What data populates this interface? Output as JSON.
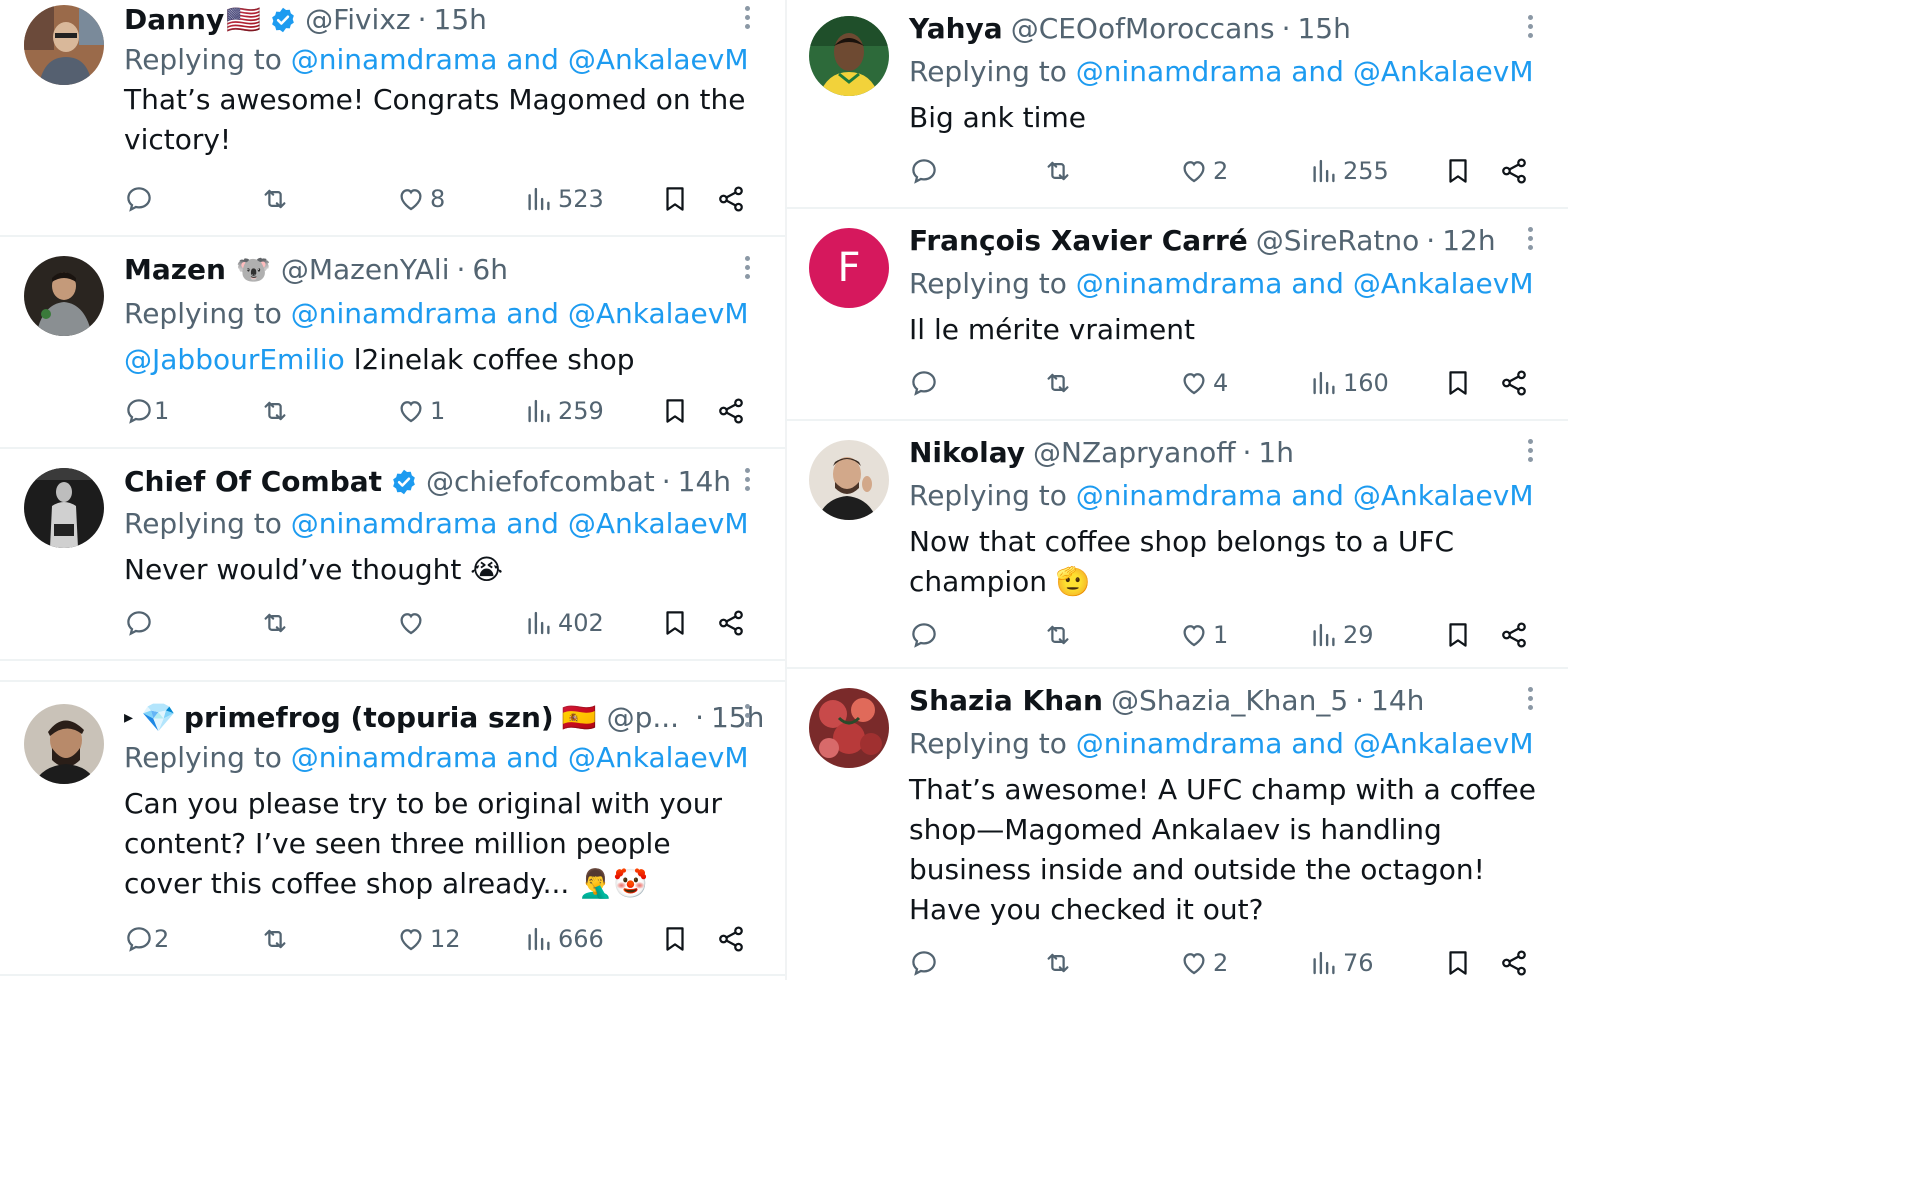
{
  "colors": {
    "mention": "#1d9bf0",
    "muted": "#536471",
    "text": "#0f1419",
    "verified": "#1d9bf0"
  },
  "left_column": [
    {
      "name": "Danny",
      "name_emoji": "🇺🇸",
      "verified": true,
      "handle": "@Fivixz",
      "time": "15h",
      "replying_prefix": "Replying to",
      "replying_mentions": "@ninamdrama and @AnkalaevM",
      "body": "That’s awesome! Congrats Magomed on the victory!",
      "counts": {
        "replies": "",
        "reposts": "",
        "likes": "8",
        "views": "523"
      }
    },
    {
      "name": "Mazen",
      "name_emoji": "🐨",
      "verified": false,
      "handle": "@MazenYAli",
      "time": "6h",
      "replying_prefix": "Replying to",
      "replying_mentions": "@ninamdrama and @AnkalaevM",
      "body_mention": "@JabbourEmilio",
      "body": " l2inelak coffee shop",
      "counts": {
        "replies": "1",
        "reposts": "",
        "likes": "1",
        "views": "259"
      }
    },
    {
      "name": "Chief Of Combat",
      "verified": true,
      "handle": "@chiefofcombat",
      "time": "14h",
      "replying_prefix": "Replying to",
      "replying_mentions": "@ninamdrama and @AnkalaevM",
      "body": "Never would’ve thought 😭",
      "counts": {
        "replies": "",
        "reposts": "",
        "likes": "",
        "views": "402"
      }
    },
    {
      "caret": "▸",
      "name_prefix_emoji": "💎",
      "name": "primefrog (topuria szn)",
      "name_emoji": "🇪🇸",
      "verified": false,
      "handle": "@p...",
      "time": "15h",
      "replying_prefix": "Replying to",
      "replying_mentions": "@ninamdrama and @AnkalaevM",
      "body": "Can you please try to be original with your content? I’ve seen three million people cover this coffee shop already... 🤦‍♂️🤡",
      "counts": {
        "replies": "2",
        "reposts": "",
        "likes": "12",
        "views": "666"
      }
    }
  ],
  "right_column": [
    {
      "name": "Yahya",
      "verified": false,
      "handle": "@CEOofMoroccans",
      "time": "15h",
      "replying_prefix": "Replying to",
      "replying_mentions": "@ninamdrama and @AnkalaevM",
      "body": "Big ank time",
      "counts": {
        "replies": "",
        "reposts": "",
        "likes": "2",
        "views": "255"
      }
    },
    {
      "avatar_letter": "F",
      "name": "François Xavier Carré",
      "verified": false,
      "handle": "@SireRatno",
      "time": "12h",
      "replying_prefix": "Replying to",
      "replying_mentions": "@ninamdrama and @AnkalaevM",
      "body": "Il le mérite vraiment",
      "counts": {
        "replies": "",
        "reposts": "",
        "likes": "4",
        "views": "160"
      }
    },
    {
      "name": "Nikolay",
      "verified": false,
      "handle": "@NZapryanoff",
      "time": "1h",
      "replying_prefix": "Replying to",
      "replying_mentions": "@ninamdrama and @AnkalaevM",
      "body": "Now that coffee shop belongs to a UFC champion 🫡",
      "counts": {
        "replies": "",
        "reposts": "",
        "likes": "1",
        "views": "29"
      }
    },
    {
      "name": "Shazia Khan",
      "verified": false,
      "handle": "@Shazia_Khan_5",
      "time": "14h",
      "replying_prefix": "Replying to",
      "replying_mentions": "@ninamdrama and @AnkalaevM",
      "body": "That’s awesome! A UFC champ with a coffee shop—Magomed Ankalaev is handling business inside and outside the octagon! Have you checked it out?",
      "counts": {
        "replies": "",
        "reposts": "",
        "likes": "2",
        "views": "76"
      }
    }
  ],
  "icons": [
    "reply-icon",
    "repost-icon",
    "like-icon",
    "views-icon",
    "bookmark-icon",
    "share-icon",
    "more-icon",
    "verified-badge-icon"
  ]
}
